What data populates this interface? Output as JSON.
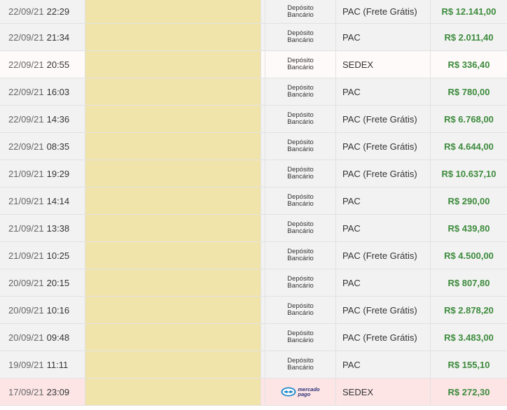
{
  "payment_labels": {
    "deposito": [
      "Depósito",
      "Bancário"
    ],
    "mercadopago": [
      "mercado",
      "pago"
    ]
  },
  "rows": [
    {
      "date": "22/09/21",
      "time": "22:29",
      "payment": "deposito",
      "shipping": "PAC (Frete Grátis)",
      "total": "R$ 12.141,00",
      "bg": "gray"
    },
    {
      "date": "22/09/21",
      "time": "21:34",
      "payment": "deposito",
      "shipping": "PAC",
      "total": "R$ 2.011,40",
      "bg": "gray"
    },
    {
      "date": "22/09/21",
      "time": "20:55",
      "payment": "deposito",
      "shipping": "SEDEX",
      "total": "R$ 336,40",
      "bg": "white"
    },
    {
      "date": "22/09/21",
      "time": "16:03",
      "payment": "deposito",
      "shipping": "PAC",
      "total": "R$ 780,00",
      "bg": "gray"
    },
    {
      "date": "22/09/21",
      "time": "14:36",
      "payment": "deposito",
      "shipping": "PAC (Frete Grátis)",
      "total": "R$ 6.768,00",
      "bg": "gray"
    },
    {
      "date": "22/09/21",
      "time": "08:35",
      "payment": "deposito",
      "shipping": "PAC (Frete Grátis)",
      "total": "R$ 4.644,00",
      "bg": "gray"
    },
    {
      "date": "21/09/21",
      "time": "19:29",
      "payment": "deposito",
      "shipping": "PAC (Frete Grátis)",
      "total": "R$ 10.637,10",
      "bg": "gray"
    },
    {
      "date": "21/09/21",
      "time": "14:14",
      "payment": "deposito",
      "shipping": "PAC",
      "total": "R$ 290,00",
      "bg": "gray"
    },
    {
      "date": "21/09/21",
      "time": "13:38",
      "payment": "deposito",
      "shipping": "PAC",
      "total": "R$ 439,80",
      "bg": "gray"
    },
    {
      "date": "21/09/21",
      "time": "10:25",
      "payment": "deposito",
      "shipping": "PAC (Frete Grátis)",
      "total": "R$ 4.500,00",
      "bg": "gray"
    },
    {
      "date": "20/09/21",
      "time": "20:15",
      "payment": "deposito",
      "shipping": "PAC",
      "total": "R$ 807,80",
      "bg": "gray"
    },
    {
      "date": "20/09/21",
      "time": "10:16",
      "payment": "deposito",
      "shipping": "PAC (Frete Grátis)",
      "total": "R$ 2.878,20",
      "bg": "gray"
    },
    {
      "date": "20/09/21",
      "time": "09:48",
      "payment": "deposito",
      "shipping": "PAC (Frete Grátis)",
      "total": "R$ 3.483,00",
      "bg": "gray"
    },
    {
      "date": "19/09/21",
      "time": "11:11",
      "payment": "deposito",
      "shipping": "PAC",
      "total": "R$ 155,10",
      "bg": "gray"
    },
    {
      "date": "17/09/21",
      "time": "23:09",
      "payment": "mercadopago",
      "shipping": "SEDEX",
      "total": "R$ 272,30",
      "bg": "pink"
    }
  ],
  "colors": {
    "total_text": "#3d8b3d",
    "redacted_column": "#f1e4aa",
    "row_gray": "#f2f2f2",
    "row_pink": "#fde5e6"
  }
}
